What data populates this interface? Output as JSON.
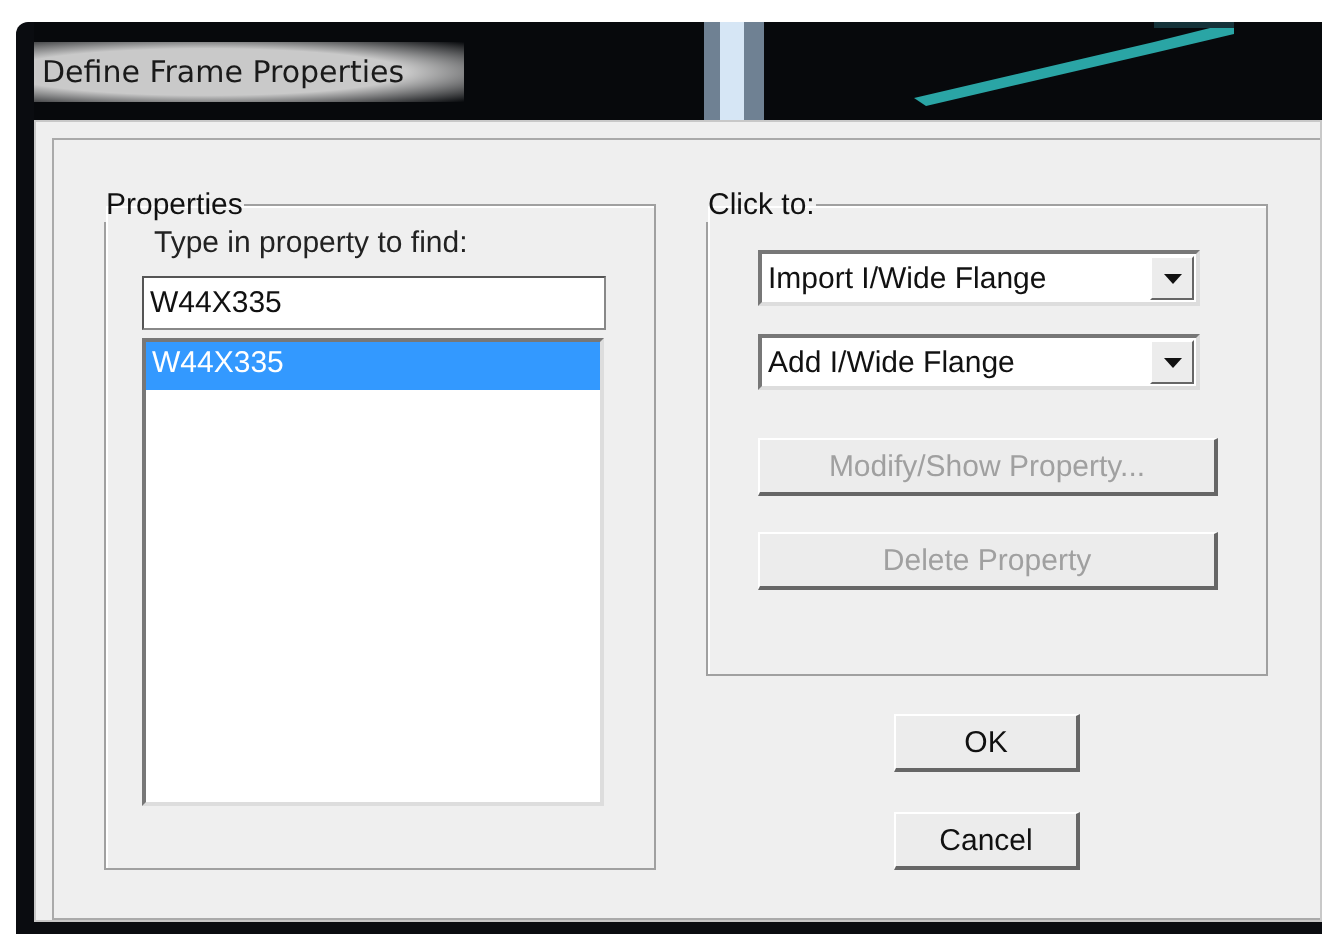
{
  "window": {
    "title": "Define Frame Properties"
  },
  "properties": {
    "title": "Properties",
    "prompt": "Type in property to find:",
    "search_value": "W44X335",
    "items": [
      {
        "label": "W44X335",
        "selected": true
      }
    ]
  },
  "click_to": {
    "title": "Click to:",
    "dropdowns": [
      {
        "value": "Import I/Wide Flange"
      },
      {
        "value": "Add I/Wide Flange"
      }
    ],
    "buttons": [
      {
        "label": "Modify/Show Property...",
        "disabled": true
      },
      {
        "label": "Delete Property",
        "disabled": true
      }
    ]
  },
  "dialog_buttons": [
    {
      "label": "OK"
    },
    {
      "label": "Cancel"
    }
  ]
}
